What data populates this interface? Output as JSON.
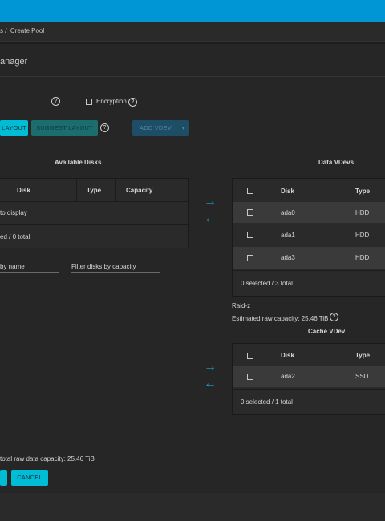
{
  "breadcrumb": {
    "prefix": "s /",
    "current": "Create Pool"
  },
  "header": {
    "title": "anager"
  },
  "pool": {
    "encryption_label": "Encryption"
  },
  "toolbar": {
    "reset_label": "LAYOUT",
    "suggest_label": "SUGGEST LAYOUT",
    "add_vdev_label": "ADD VDEV"
  },
  "available": {
    "title": "Available Disks",
    "columns": [
      "Disk",
      "Type",
      "Capacity"
    ],
    "empty_text": "to display",
    "footer": "ed / 0 total",
    "filter_name": "by name",
    "filter_capacity": "Filter disks by capacity"
  },
  "data_vdevs": {
    "title": "Data VDevs",
    "columns": [
      "Disk",
      "Type"
    ],
    "rows": [
      {
        "disk": "ada0",
        "type": "HDD"
      },
      {
        "disk": "ada1",
        "type": "HDD"
      },
      {
        "disk": "ada3",
        "type": "HDD"
      }
    ],
    "footer": "0 selected / 3 total",
    "raid_label": "Raid-z",
    "estimated": "Estimated raw capacity: 25.46 TiB"
  },
  "cache_vdev": {
    "title": "Cache VDev",
    "columns": [
      "Disk",
      "Type"
    ],
    "rows": [
      {
        "disk": "ada2",
        "type": "SSD"
      }
    ],
    "footer": "0 selected / 1 total"
  },
  "summary": {
    "total": "total raw data capacity: 25.46 TiB"
  },
  "actions": {
    "cancel_label": "CANCEL"
  },
  "colors": {
    "topbar": "#0095d5",
    "accent": "#00bcd4",
    "arrow": "#1aa0d8"
  }
}
